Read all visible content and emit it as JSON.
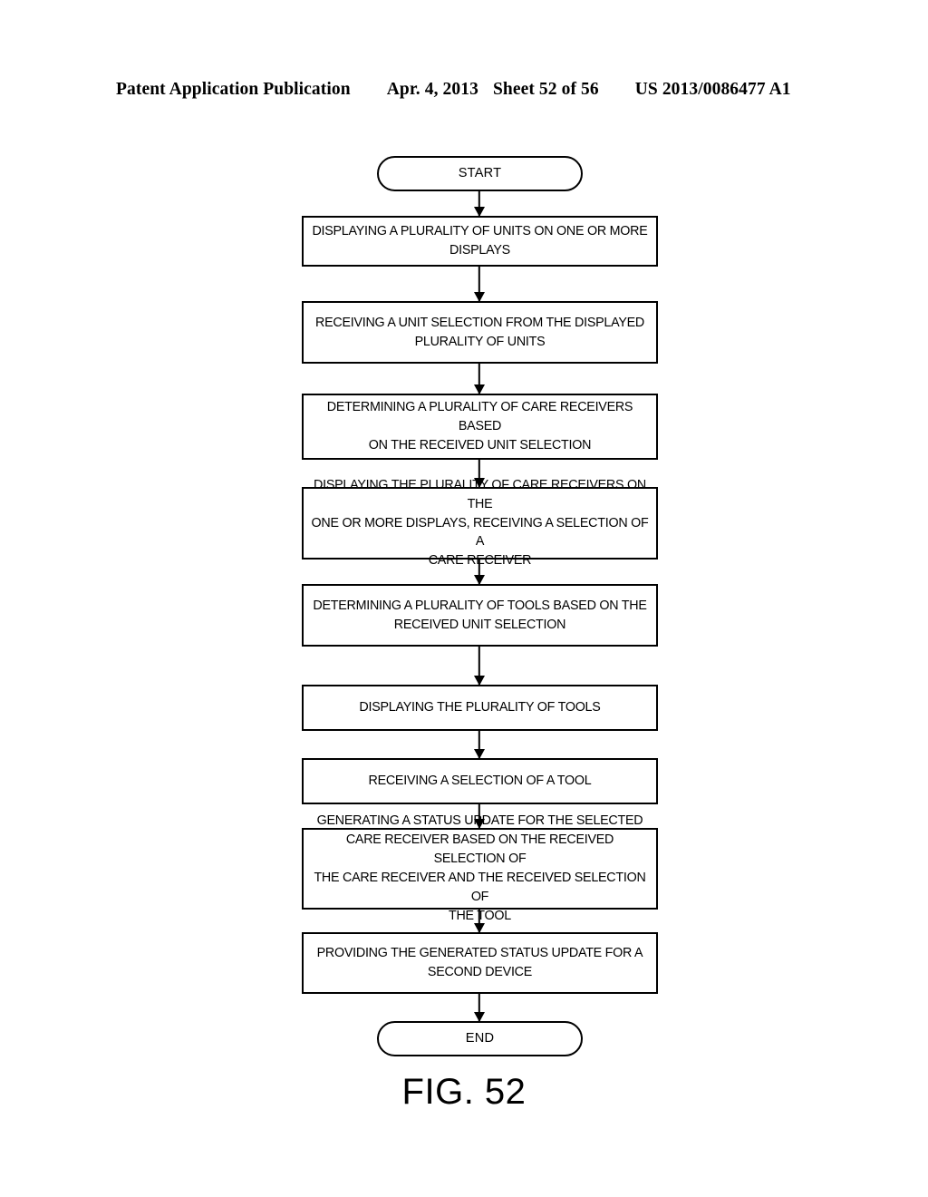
{
  "header": {
    "publication": "Patent Application Publication",
    "date": "Apr. 4, 2013",
    "sheet": "Sheet 52 of 56",
    "patent_number": "US 2013/0086477 A1"
  },
  "figure": {
    "caption": "FIG. 52"
  },
  "flowchart": {
    "nodes": [
      {
        "id": "start",
        "type": "terminator",
        "label": "START"
      },
      {
        "id": "step1",
        "type": "process",
        "label": "DISPLAYING A PLURALITY OF UNITS ON ONE OR MORE\nDISPLAYS"
      },
      {
        "id": "step2",
        "type": "process",
        "label": "RECEIVING A UNIT SELECTION FROM THE DISPLAYED\nPLURALITY OF UNITS"
      },
      {
        "id": "step3",
        "type": "process",
        "label": "DETERMINING A PLURALITY OF CARE RECEIVERS BASED\nON THE RECEIVED UNIT SELECTION"
      },
      {
        "id": "step4",
        "type": "process",
        "label": "DISPLAYING THE PLURALITY OF CARE RECEIVERS ON THE\nONE OR MORE DISPLAYS, RECEIVING A SELECTION OF A\nCARE RECEIVER"
      },
      {
        "id": "step5",
        "type": "process",
        "label": "DETERMINING A PLURALITY OF TOOLS BASED ON THE\nRECEIVED UNIT SELECTION"
      },
      {
        "id": "step6",
        "type": "process",
        "label": "DISPLAYING THE PLURALITY OF TOOLS"
      },
      {
        "id": "step7",
        "type": "process",
        "label": "RECEIVING A SELECTION OF A TOOL"
      },
      {
        "id": "step8",
        "type": "process",
        "label": "GENERATING A STATUS UPDATE FOR THE SELECTED\nCARE RECEIVER BASED ON THE RECEIVED SELECTION OF\nTHE CARE RECEIVER AND THE RECEIVED SELECTION OF\nTHE TOOL"
      },
      {
        "id": "step9",
        "type": "process",
        "label": "PROVIDING THE GENERATED STATUS UPDATE FOR A\nSECOND DEVICE"
      },
      {
        "id": "end",
        "type": "terminator",
        "label": "END"
      }
    ],
    "edges": [
      {
        "from": "start",
        "to": "step1"
      },
      {
        "from": "step1",
        "to": "step2"
      },
      {
        "from": "step2",
        "to": "step3"
      },
      {
        "from": "step3",
        "to": "step4"
      },
      {
        "from": "step4",
        "to": "step5"
      },
      {
        "from": "step5",
        "to": "step6"
      },
      {
        "from": "step6",
        "to": "step7"
      },
      {
        "from": "step7",
        "to": "step8"
      },
      {
        "from": "step8",
        "to": "step9"
      },
      {
        "from": "step9",
        "to": "end"
      }
    ]
  },
  "colors": {
    "stroke": "#000000",
    "fill": "#ffffff",
    "text": "#000000"
  }
}
